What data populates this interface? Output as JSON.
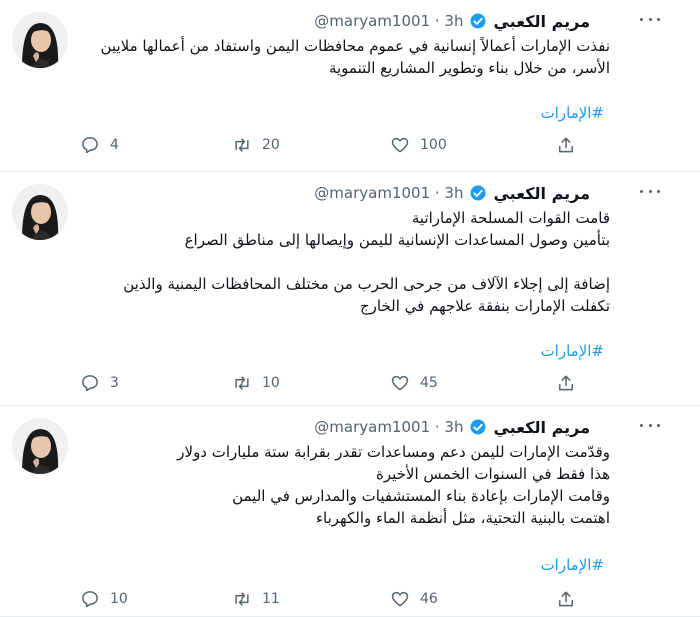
{
  "colors": {
    "accent": "#1d9bf0",
    "muted": "#536471",
    "text": "#0f1419",
    "divider": "#e6ecf0"
  },
  "tweets": [
    {
      "author": "مريم الكعبي",
      "handle": "@maryam1001 · 3h",
      "lines": [
        "نفذت الإمارات أعمالاً إنسانية في عموم محافظات اليمن واستفاد من أعمالها ملايين",
        "الأسر، من خلال بناء وتطوير المشاريع التنموية"
      ],
      "hashtag": "#الإمارات",
      "replies": "4",
      "retweets": "20",
      "likes": "100"
    },
    {
      "author": "مريم الكعبي",
      "handle": "@maryam1001 · 3h",
      "lines": [
        "قامت القوات المسلحة الإماراتية",
        "بتأمين وصول المساعدات الإنسانية لليمن وإيصالها إلى مناطق الصراع",
        "إضافة إلى  إجلاء الآلاف من جرحى الحرب من مختلف المحافظات اليمنية والذين",
        "تكفلت الإمارات بنفقة علاجهم في الخارج"
      ],
      "hashtag": "#الإمارات",
      "replies": "3",
      "retweets": "10",
      "likes": "45"
    },
    {
      "author": "مريم الكعبي",
      "handle": "@maryam1001 · 3h",
      "lines": [
        "وقدّمت الإمارات لليمن دعم ومساعدات  تقدر بقرابة ستة مليارات دولار",
        "هذا فقط في السنوات الخمس الأخيرة",
        "وقامت الإمارات بإعادة بناء المستشفيات والمدارس في اليمن",
        "اهتمت بالبنية التحتية، مثل أنظمة الماء والكهرباء"
      ],
      "hashtag": "#الإمارات",
      "replies": "10",
      "retweets": "11",
      "likes": "46"
    }
  ]
}
